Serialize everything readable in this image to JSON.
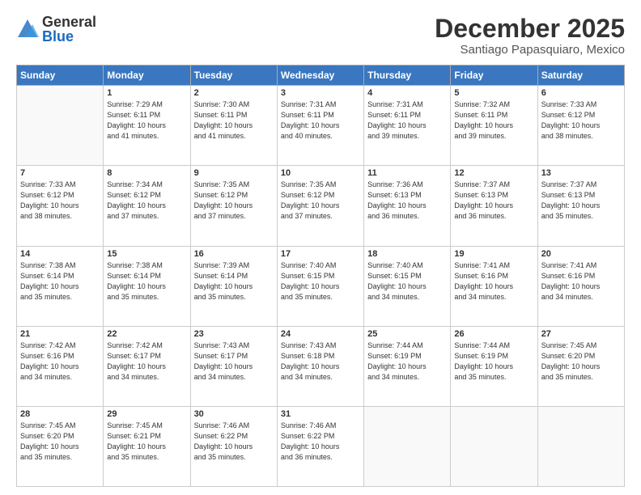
{
  "logo": {
    "general": "General",
    "blue": "Blue"
  },
  "header": {
    "month": "December 2025",
    "location": "Santiago Papasquiaro, Mexico"
  },
  "weekdays": [
    "Sunday",
    "Monday",
    "Tuesday",
    "Wednesday",
    "Thursday",
    "Friday",
    "Saturday"
  ],
  "weeks": [
    [
      {
        "day": "",
        "info": ""
      },
      {
        "day": "1",
        "info": "Sunrise: 7:29 AM\nSunset: 6:11 PM\nDaylight: 10 hours\nand 41 minutes."
      },
      {
        "day": "2",
        "info": "Sunrise: 7:30 AM\nSunset: 6:11 PM\nDaylight: 10 hours\nand 41 minutes."
      },
      {
        "day": "3",
        "info": "Sunrise: 7:31 AM\nSunset: 6:11 PM\nDaylight: 10 hours\nand 40 minutes."
      },
      {
        "day": "4",
        "info": "Sunrise: 7:31 AM\nSunset: 6:11 PM\nDaylight: 10 hours\nand 39 minutes."
      },
      {
        "day": "5",
        "info": "Sunrise: 7:32 AM\nSunset: 6:11 PM\nDaylight: 10 hours\nand 39 minutes."
      },
      {
        "day": "6",
        "info": "Sunrise: 7:33 AM\nSunset: 6:12 PM\nDaylight: 10 hours\nand 38 minutes."
      }
    ],
    [
      {
        "day": "7",
        "info": "Sunrise: 7:33 AM\nSunset: 6:12 PM\nDaylight: 10 hours\nand 38 minutes."
      },
      {
        "day": "8",
        "info": "Sunrise: 7:34 AM\nSunset: 6:12 PM\nDaylight: 10 hours\nand 37 minutes."
      },
      {
        "day": "9",
        "info": "Sunrise: 7:35 AM\nSunset: 6:12 PM\nDaylight: 10 hours\nand 37 minutes."
      },
      {
        "day": "10",
        "info": "Sunrise: 7:35 AM\nSunset: 6:12 PM\nDaylight: 10 hours\nand 37 minutes."
      },
      {
        "day": "11",
        "info": "Sunrise: 7:36 AM\nSunset: 6:13 PM\nDaylight: 10 hours\nand 36 minutes."
      },
      {
        "day": "12",
        "info": "Sunrise: 7:37 AM\nSunset: 6:13 PM\nDaylight: 10 hours\nand 36 minutes."
      },
      {
        "day": "13",
        "info": "Sunrise: 7:37 AM\nSunset: 6:13 PM\nDaylight: 10 hours\nand 35 minutes."
      }
    ],
    [
      {
        "day": "14",
        "info": "Sunrise: 7:38 AM\nSunset: 6:14 PM\nDaylight: 10 hours\nand 35 minutes."
      },
      {
        "day": "15",
        "info": "Sunrise: 7:38 AM\nSunset: 6:14 PM\nDaylight: 10 hours\nand 35 minutes."
      },
      {
        "day": "16",
        "info": "Sunrise: 7:39 AM\nSunset: 6:14 PM\nDaylight: 10 hours\nand 35 minutes."
      },
      {
        "day": "17",
        "info": "Sunrise: 7:40 AM\nSunset: 6:15 PM\nDaylight: 10 hours\nand 35 minutes."
      },
      {
        "day": "18",
        "info": "Sunrise: 7:40 AM\nSunset: 6:15 PM\nDaylight: 10 hours\nand 34 minutes."
      },
      {
        "day": "19",
        "info": "Sunrise: 7:41 AM\nSunset: 6:16 PM\nDaylight: 10 hours\nand 34 minutes."
      },
      {
        "day": "20",
        "info": "Sunrise: 7:41 AM\nSunset: 6:16 PM\nDaylight: 10 hours\nand 34 minutes."
      }
    ],
    [
      {
        "day": "21",
        "info": "Sunrise: 7:42 AM\nSunset: 6:16 PM\nDaylight: 10 hours\nand 34 minutes."
      },
      {
        "day": "22",
        "info": "Sunrise: 7:42 AM\nSunset: 6:17 PM\nDaylight: 10 hours\nand 34 minutes."
      },
      {
        "day": "23",
        "info": "Sunrise: 7:43 AM\nSunset: 6:17 PM\nDaylight: 10 hours\nand 34 minutes."
      },
      {
        "day": "24",
        "info": "Sunrise: 7:43 AM\nSunset: 6:18 PM\nDaylight: 10 hours\nand 34 minutes."
      },
      {
        "day": "25",
        "info": "Sunrise: 7:44 AM\nSunset: 6:19 PM\nDaylight: 10 hours\nand 34 minutes."
      },
      {
        "day": "26",
        "info": "Sunrise: 7:44 AM\nSunset: 6:19 PM\nDaylight: 10 hours\nand 35 minutes."
      },
      {
        "day": "27",
        "info": "Sunrise: 7:45 AM\nSunset: 6:20 PM\nDaylight: 10 hours\nand 35 minutes."
      }
    ],
    [
      {
        "day": "28",
        "info": "Sunrise: 7:45 AM\nSunset: 6:20 PM\nDaylight: 10 hours\nand 35 minutes."
      },
      {
        "day": "29",
        "info": "Sunrise: 7:45 AM\nSunset: 6:21 PM\nDaylight: 10 hours\nand 35 minutes."
      },
      {
        "day": "30",
        "info": "Sunrise: 7:46 AM\nSunset: 6:22 PM\nDaylight: 10 hours\nand 35 minutes."
      },
      {
        "day": "31",
        "info": "Sunrise: 7:46 AM\nSunset: 6:22 PM\nDaylight: 10 hours\nand 36 minutes."
      },
      {
        "day": "",
        "info": ""
      },
      {
        "day": "",
        "info": ""
      },
      {
        "day": "",
        "info": ""
      }
    ]
  ]
}
